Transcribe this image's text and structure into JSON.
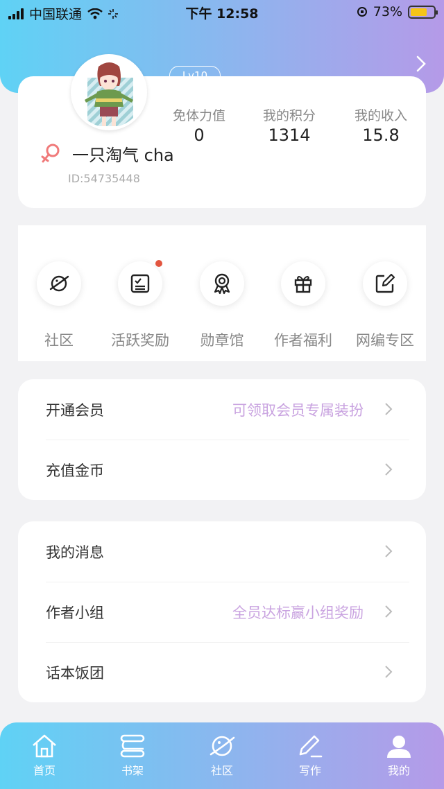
{
  "status_bar": {
    "carrier": "中国联通",
    "time": "下午 12:58",
    "battery": "73%",
    "battery_level": 0.73
  },
  "profile": {
    "level": "Lv10",
    "username": "一只淘气 cha",
    "user_id": "ID:54735448",
    "stats": [
      {
        "label": "免体力值",
        "value": "0"
      },
      {
        "label": "我的积分",
        "value": "1314"
      },
      {
        "label": "我的收入",
        "value": "15.8"
      }
    ]
  },
  "shortcuts": [
    {
      "label": "社区",
      "icon": "planet-icon",
      "badge": false
    },
    {
      "label": "活跃奖励",
      "icon": "checklist-icon",
      "badge": true
    },
    {
      "label": "勋章馆",
      "icon": "medal-icon",
      "badge": false
    },
    {
      "label": "作者福利",
      "icon": "gift-icon",
      "badge": false
    },
    {
      "label": "网编专区",
      "icon": "edit-icon",
      "badge": false
    }
  ],
  "menu_group_1": [
    {
      "title": "开通会员",
      "extra": "可领取会员专属装扮"
    },
    {
      "title": "充值金币",
      "extra": ""
    }
  ],
  "menu_group_2": [
    {
      "title": "我的消息",
      "extra": ""
    },
    {
      "title": "作者小组",
      "extra": "全员达标赢小组奖励"
    },
    {
      "title": "话本饭团",
      "extra": ""
    }
  ],
  "tabbar": [
    {
      "label": "首页",
      "icon": "home-icon"
    },
    {
      "label": "书架",
      "icon": "bookshelf-icon"
    },
    {
      "label": "社区",
      "icon": "planet-icon"
    },
    {
      "label": "写作",
      "icon": "pen-icon"
    },
    {
      "label": "我的",
      "icon": "user-icon",
      "active": true
    }
  ],
  "colors": {
    "gradient_start": "#5fd2f5",
    "gradient_end": "#b59ae8",
    "accent_text": "#c9a3e0",
    "badge_dot": "#e2553f",
    "female_icon": "#f07a7a"
  }
}
